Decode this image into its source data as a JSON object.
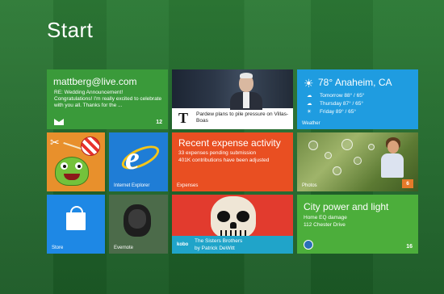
{
  "start": {
    "title": "Start"
  },
  "mail": {
    "account": "mattberg@live.com",
    "subject": "RE: Wedding Announcement!",
    "preview": "Congratulations! I'm really excited to celebrate with you all. Thanks for the ...",
    "count": "12",
    "icon": "envelope-icon"
  },
  "news": {
    "source_logo": "T",
    "headline": "Pardew plans to pile pressure on Villas-Boas"
  },
  "weather": {
    "current": "78° Anaheim, CA",
    "forecast": [
      {
        "text": "Tomorrow  88° / 65°",
        "icon": "partly-cloudy-icon"
      },
      {
        "text": "Thursday  87° / 65°",
        "icon": "partly-cloudy-icon"
      },
      {
        "text": "Friday  89° / 65°",
        "icon": "sun-icon"
      }
    ],
    "label": "Weather",
    "colors": {
      "background": "#1f9ce0"
    }
  },
  "game": {
    "name": "Cut the Rope"
  },
  "ie": {
    "label": "Internet Explorer"
  },
  "expenses": {
    "title": "Recent expense activity",
    "line1": "33 expenses pending submission",
    "line2": "401K contributions have been adjusted",
    "label": "Expenses",
    "colors": {
      "background": "#e94f22"
    }
  },
  "photos": {
    "label": "Photos",
    "count": "6"
  },
  "store": {
    "label": "Store"
  },
  "evernote": {
    "label": "Evernote"
  },
  "movie": {
    "brand": "kobo",
    "title": "The Sisters Brothers",
    "author": "by Patrick DeWitt"
  },
  "city": {
    "title": "City power and light",
    "line1": "Home EQ damage",
    "line2": "112 Chester Drive",
    "count": "16",
    "colors": {
      "background": "#4cae3b"
    }
  }
}
